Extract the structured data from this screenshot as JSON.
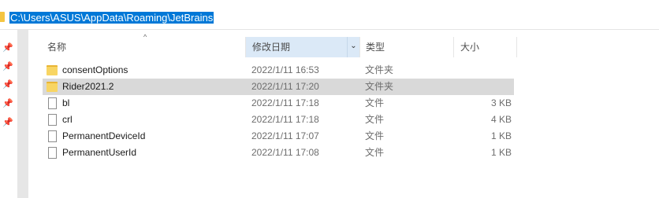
{
  "address": {
    "path": "C:\\Users\\ASUS\\AppData\\Roaming\\JetBrains"
  },
  "nav": {
    "pins": [
      "pin-icon",
      "pin-icon",
      "pin-icon",
      "pin-icon",
      "pin-icon"
    ]
  },
  "columns": {
    "name": "名称",
    "date": "修改日期",
    "type": "类型",
    "size": "大小",
    "sort_indicator": "^",
    "dropdown": "⌄"
  },
  "files": [
    {
      "name": "consentOptions",
      "date": "2022/1/11 16:53",
      "type": "文件夹",
      "size": "",
      "kind": "folder"
    },
    {
      "name": "Rider2021.2",
      "date": "2022/1/11 17:20",
      "type": "文件夹",
      "size": "",
      "kind": "folder"
    },
    {
      "name": "bl",
      "date": "2022/1/11 17:18",
      "type": "文件",
      "size": "3 KB",
      "kind": "file"
    },
    {
      "name": "crl",
      "date": "2022/1/11 17:18",
      "type": "文件",
      "size": "4 KB",
      "kind": "file"
    },
    {
      "name": "PermanentDeviceId",
      "date": "2022/1/11 17:07",
      "type": "文件",
      "size": "1 KB",
      "kind": "file"
    },
    {
      "name": "PermanentUserId",
      "date": "2022/1/11 17:08",
      "type": "文件",
      "size": "1 KB",
      "kind": "file"
    }
  ]
}
